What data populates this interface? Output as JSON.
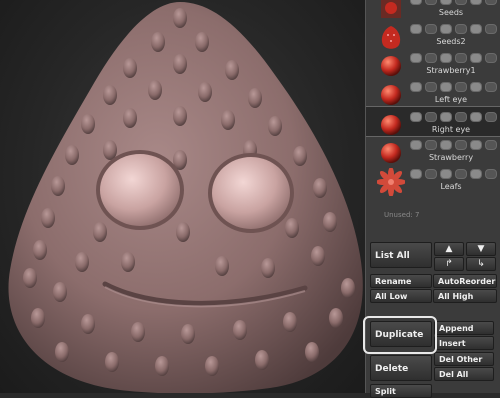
{
  "colors": {
    "model": "#8c6d6c",
    "panel_bg": "#3b3b3b",
    "selected_bg": "#2a2a2a",
    "highlight": "#e8e8e8",
    "thumb_red": "#c42a20"
  },
  "subtools": [
    {
      "label": "Seeds",
      "icon": "seeds-thumbnail"
    },
    {
      "label": "Seeds2",
      "icon": "strawberry-thumbnail"
    },
    {
      "label": "Strawberry1",
      "icon": "red-sphere-thumbnail"
    },
    {
      "label": "Left eye",
      "icon": "red-sphere-thumbnail"
    },
    {
      "label": "Right eye",
      "icon": "red-sphere-thumbnail",
      "selected": true
    },
    {
      "label": "Strawberry",
      "icon": "red-sphere-thumbnail"
    },
    {
      "label": "Leafs",
      "icon": "leaf-star-thumbnail"
    }
  ],
  "unused_label": "Unused: 7",
  "buttons": {
    "list_all": "List All",
    "rename": "Rename",
    "auto_reorder": "AutoReorder",
    "all_low": "All Low",
    "all_high": "All High",
    "duplicate": "Duplicate",
    "append": "Append",
    "insert": "Insert",
    "delete": "Delete",
    "del_other": "Del Other",
    "del_all": "Del All",
    "split": "Split"
  },
  "arrows": {
    "up": "▲",
    "down": "▼",
    "up_right": "↱",
    "down_right": "↳"
  }
}
